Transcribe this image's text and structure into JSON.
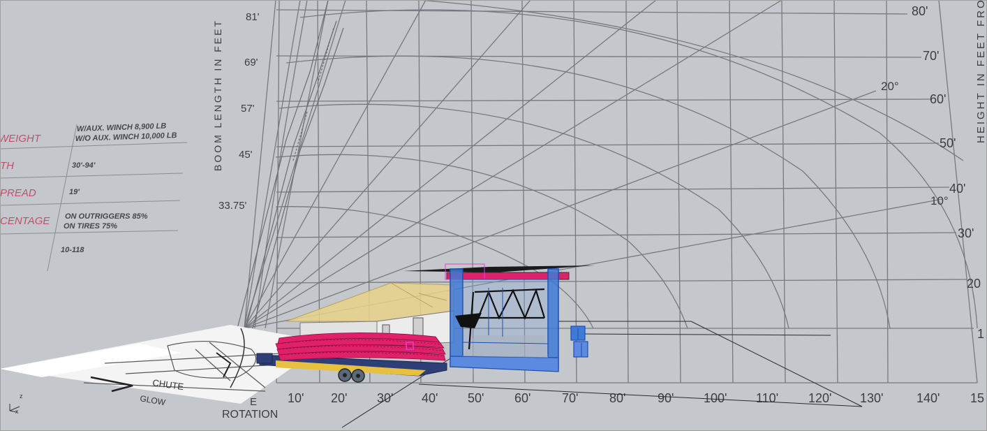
{
  "viewport": {
    "name": "3D Viewport",
    "background": "#c4c7cb"
  },
  "chart_backdrop": {
    "boom_axis_label": "BOOM LENGTH IN FEET",
    "boom_ticks": [
      "81'",
      "69'",
      "57'",
      "45'",
      "33.75'"
    ],
    "height_axis_label": "HEIGHT IN FEET FROM",
    "height_ticks": [
      "80'",
      "70'",
      "60'",
      "50'",
      "40'",
      "30'",
      "20",
      "1"
    ],
    "angle_labels": [
      "20°",
      "10°"
    ],
    "radius_ticks": [
      "10'",
      "20'",
      "30'",
      "40'",
      "50'",
      "60'",
      "70'",
      "80'",
      "90'",
      "100'",
      "110'",
      "120'",
      "130'",
      "140'",
      "15"
    ],
    "rotation_label": "ROTATION",
    "rotation_letter": "E"
  },
  "spec_table": {
    "rows": [
      {
        "label": "WEIGHT",
        "value1": "W/AUX. WINCH 8,900 LB",
        "value2": "W/O AUX. WINCH 10,000 LB"
      },
      {
        "label": "TH",
        "value1": "30'-94'",
        "value2": ""
      },
      {
        "label": "PREAD",
        "value1": "19'",
        "value2": ""
      },
      {
        "label": "CENTAGE",
        "value1": "ON OUTRIGGERS 85%",
        "value2": "ON TIRES 75%"
      },
      {
        "label": "",
        "value1": "10-118",
        "value2": ""
      }
    ],
    "label_color": "#c0506e"
  },
  "ground_map": {
    "labels": [
      "CHUTE",
      "GLOW"
    ]
  },
  "gizmo": {
    "axis_z": "z",
    "axis_x": "x"
  },
  "colors": {
    "grid": "#7c7f83",
    "stage_blue": "#3f7ad6",
    "seating_pink": "#e0206a",
    "roof_yellow": "#e6cf7a",
    "trailer_navy": "#2e3f78",
    "selection_magenta": "#e040d0"
  }
}
